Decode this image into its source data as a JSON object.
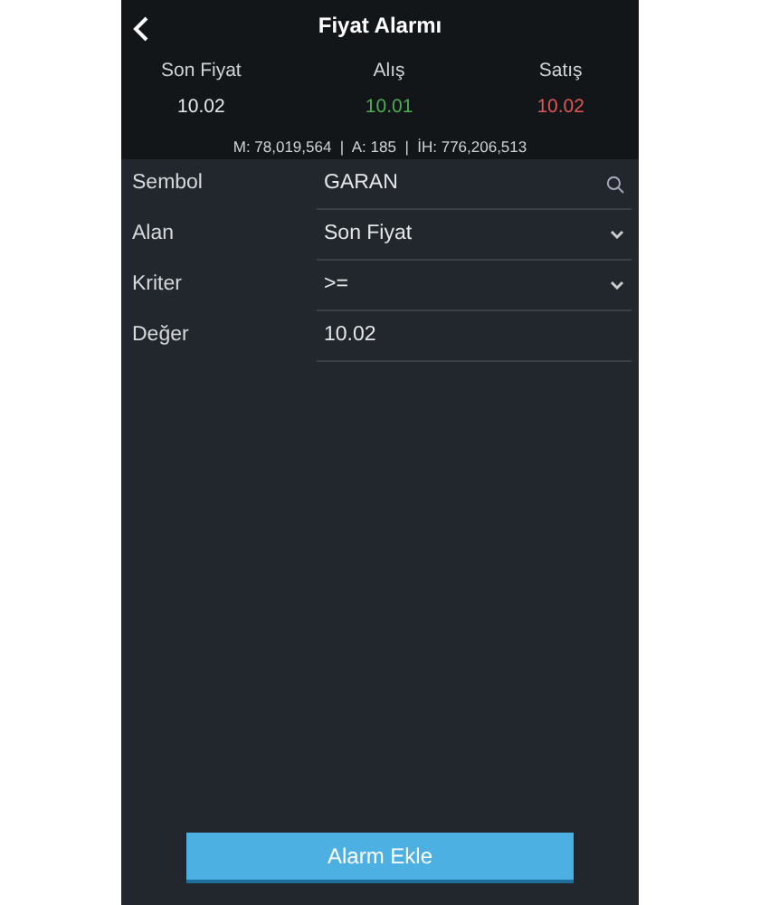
{
  "header": {
    "title": "Fiyat Alarmı"
  },
  "quote": [
    {
      "label": "Son Fiyat",
      "value": "10.02",
      "color": "#e6e8ea"
    },
    {
      "label": "Alış",
      "value": "10.01",
      "color": "#4caf50"
    },
    {
      "label": "Satış",
      "value": "10.02",
      "color": "#e05757"
    }
  ],
  "stats": "M: 78,019,564  |  A: 185  |  İH: 776,206,513",
  "form": [
    {
      "label": "Sembol",
      "value": "GARAN",
      "kind": "search"
    },
    {
      "label": "Alan",
      "value": "Son Fiyat",
      "kind": "select"
    },
    {
      "label": "Kriter",
      "value": ">=",
      "kind": "select"
    },
    {
      "label": "Değer",
      "value": "10.02",
      "kind": "text"
    }
  ],
  "button": "Alarm Ekle"
}
